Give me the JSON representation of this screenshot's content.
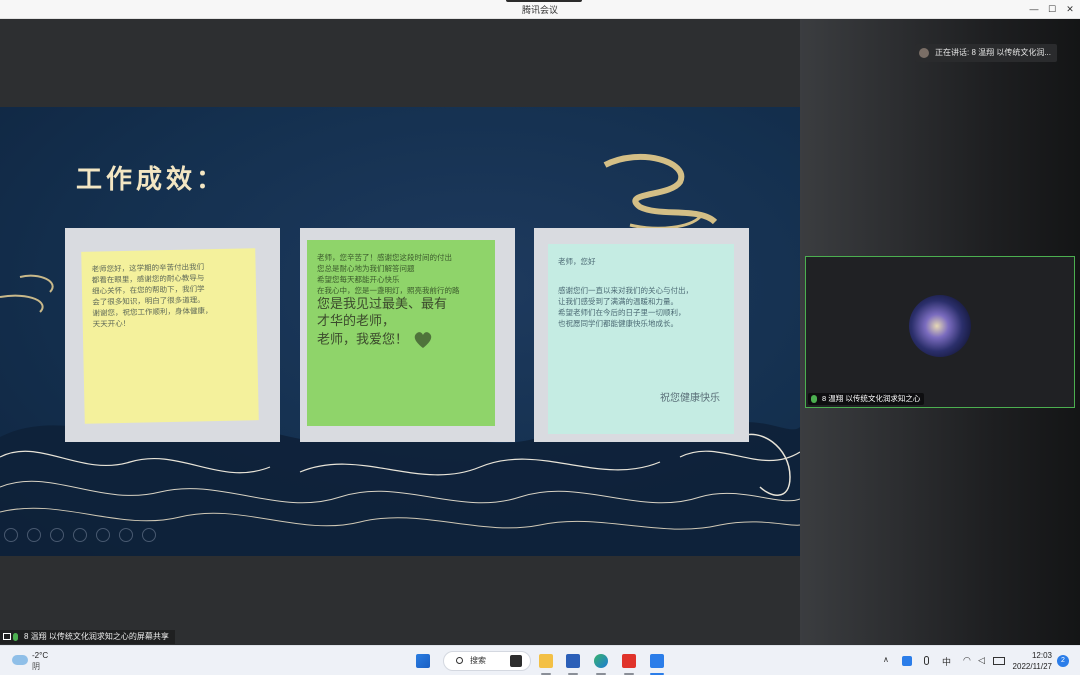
{
  "window": {
    "title": "腾讯会议",
    "minimize": "—",
    "maximize": "☐",
    "close": "✕"
  },
  "slide": {
    "title": "工作成效：",
    "note1_lines": [
      "老师您好，这学期的辛苦付出我们",
      "都看在眼里，感谢您的耐心教导与",
      "细心关怀，在您的帮助下，我们学",
      "会了很多知识，明白了很多道理。",
      "谢谢您，祝您工作顺利，身体健康，",
      "天天开心！"
    ],
    "note2_lines": [
      "老师，您辛苦了！感谢您这段时间的付出",
      "您总是耐心地为我们解答问题",
      "希望您每天都能开心快乐",
      "在我心中，您是一盏明灯，照亮我前行的路"
    ],
    "note2_big": [
      "您是我见过最美、最有",
      "才华的老师，",
      "老师，我爱您！"
    ],
    "note3_header": "老师，您好",
    "note3_lines": [
      "感谢您们一直以来对我们的关心与付出，",
      "让我们感受到了满满的温暖和力量。",
      "希望老师们在今后的日子里一切顺利，",
      "也祝愿同学们都能健康快乐地成长。"
    ],
    "note3_sign": "祝您健康快乐"
  },
  "side": {
    "speaking_text": "正在讲话: 8 温翔 以传统文化润...",
    "participant_label": "8 温翔 以传统文化润求知之心"
  },
  "share_label": "8 温翔 以传统文化润求知之心的屏幕共享",
  "taskbar": {
    "temperature": "-2°C",
    "condition": "阴",
    "search_label": "搜索",
    "ime": "中",
    "time": "12:03",
    "date": "2022/11/27",
    "notification_count": "2",
    "chevron": "∧"
  },
  "colors": {
    "accent": "#2b7de9",
    "active_border": "#4caf50",
    "slide_bg": "#14304f"
  }
}
